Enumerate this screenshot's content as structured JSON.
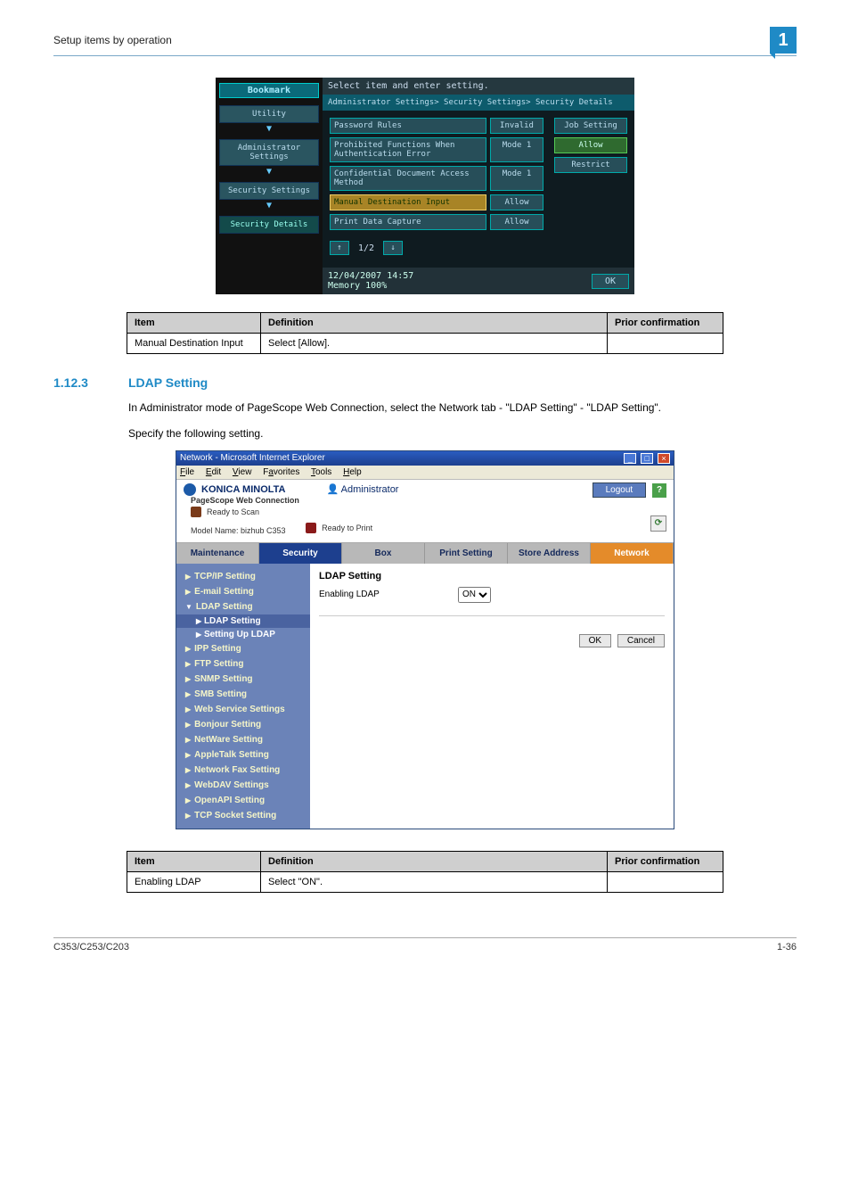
{
  "header": {
    "title": "Setup items by operation",
    "badge": "1"
  },
  "device": {
    "prompt": "Select item and enter setting.",
    "bookmark": "Bookmark",
    "breadcrumbs": [
      "Utility",
      "Administrator Settings",
      "Security Settings",
      "Security Details"
    ],
    "path": "Administrator Settings> Security Settings> Security Details",
    "rows": [
      {
        "label": "Password Rules",
        "val": "Invalid",
        "hl": false
      },
      {
        "label": "Prohibited Functions When Authentication Error",
        "val": "Mode 1",
        "hl": false
      },
      {
        "label": "Confidential Document Access Method",
        "val": "Mode 1",
        "hl": false
      },
      {
        "label": "Manual Destination Input",
        "val": "Allow",
        "hl": true
      },
      {
        "label": "Print Data Capture",
        "val": "Allow",
        "hl": false
      }
    ],
    "side": [
      {
        "label": "Job Setting",
        "style": ""
      },
      {
        "label": "Allow",
        "style": "green"
      },
      {
        "label": "Restrict",
        "style": ""
      }
    ],
    "pager": "1/2",
    "footer_date": "12/04/2007   14:57",
    "footer_mem": "Memory     100%",
    "ok": "OK"
  },
  "table1": {
    "headers": [
      "Item",
      "Definition",
      "Prior confirmation"
    ],
    "row": [
      "Manual Destination Input",
      "Select [Allow].",
      ""
    ]
  },
  "section": {
    "num": "1.12.3",
    "title": "LDAP Setting",
    "p1": "In Administrator mode of PageScope Web Connection, select the Network tab - \"LDAP Setting\" - \"LDAP Setting\".",
    "p2": "Specify the following setting."
  },
  "browser": {
    "title": "Network - Microsoft Internet Explorer",
    "menus": [
      "File",
      "Edit",
      "View",
      "Favorites",
      "Tools",
      "Help"
    ],
    "brand": "KONICA MINOLTA",
    "admin": "Administrator",
    "logout": "Logout",
    "webconn": "PageScope Web Connection",
    "model": "Model Name: bizhub C353",
    "status": [
      "Ready to Scan",
      "Ready to Print"
    ],
    "tabs": [
      "Maintenance",
      "Security",
      "Box",
      "Print Setting",
      "Store Address",
      "Network"
    ],
    "side": [
      "TCP/IP Setting",
      "E-mail Setting",
      "LDAP Setting",
      "IPP Setting",
      "FTP Setting",
      "SNMP Setting",
      "SMB Setting",
      "Web Service Settings",
      "Bonjour Setting",
      "NetWare Setting",
      "AppleTalk Setting",
      "Network Fax Setting",
      "WebDAV Settings",
      "OpenAPI Setting",
      "TCP Socket Setting"
    ],
    "sub": [
      "LDAP Setting",
      "Setting Up LDAP"
    ],
    "form": {
      "title": "LDAP Setting",
      "label": "Enabling LDAP",
      "value": "ON",
      "ok": "OK",
      "cancel": "Cancel"
    }
  },
  "table2": {
    "headers": [
      "Item",
      "Definition",
      "Prior confirmation"
    ],
    "row": [
      "Enabling LDAP",
      "Select \"ON\".",
      ""
    ]
  },
  "footer": {
    "left": "C353/C253/C203",
    "right": "1-36"
  }
}
